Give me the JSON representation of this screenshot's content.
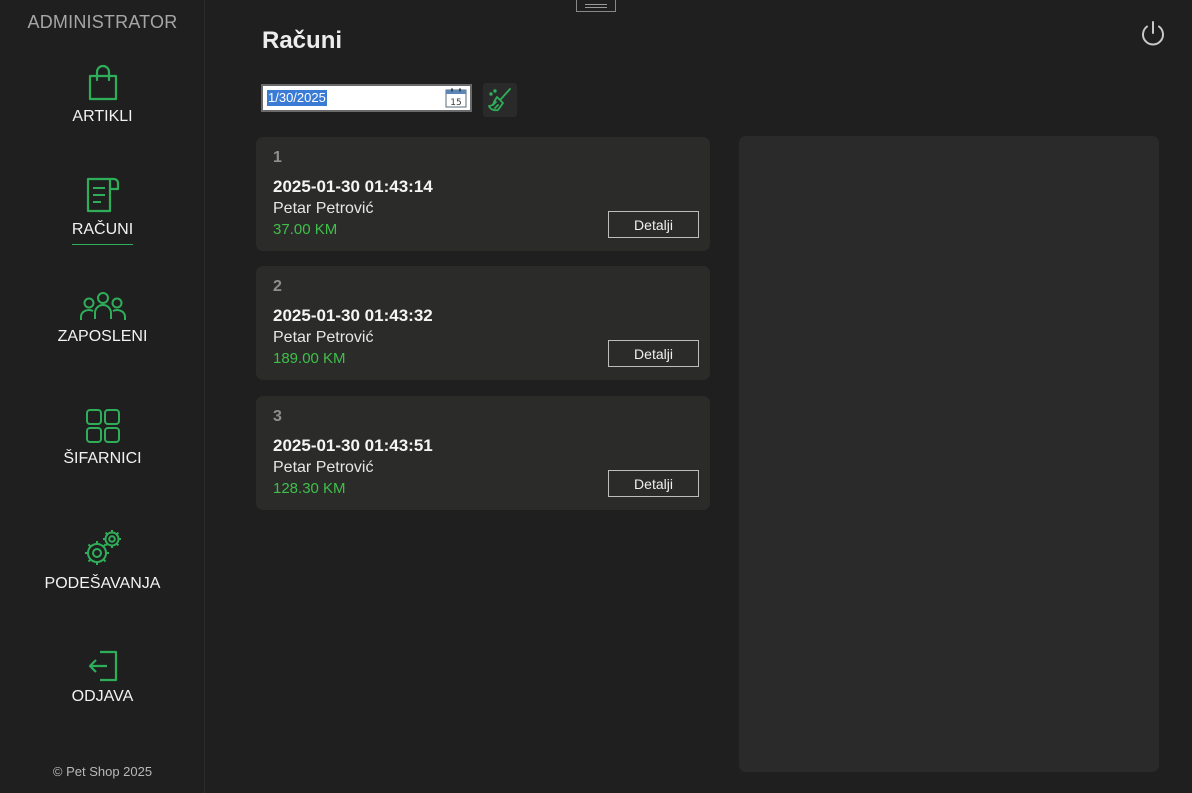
{
  "sidebar": {
    "role": "ADMINISTRATOR",
    "items": [
      {
        "label": "ARTIKLI",
        "icon": "shopping-bag-icon"
      },
      {
        "label": "RAČUNI",
        "icon": "receipt-icon",
        "active": true
      },
      {
        "label": "ZAPOSLENI",
        "icon": "users-icon"
      },
      {
        "label": "ŠIFARNICI",
        "icon": "grid-icon"
      },
      {
        "label": "PODEŠAVANJA",
        "icon": "gears-icon"
      },
      {
        "label": "ODJAVA",
        "icon": "logout-icon"
      }
    ],
    "footer": "© Pet Shop 2025"
  },
  "main": {
    "title": "Računi",
    "date_filter": {
      "value": "1/30/2025",
      "calendar_day": "15"
    },
    "bills": [
      {
        "number": "1",
        "datetime": "2025-01-30 01:43:14",
        "employee": "Petar Petrović",
        "amount": "37.00 KM",
        "details_label": "Detalji"
      },
      {
        "number": "2",
        "datetime": "2025-01-30 01:43:32",
        "employee": "Petar Petrović",
        "amount": "189.00 KM",
        "details_label": "Detalji"
      },
      {
        "number": "3",
        "datetime": "2025-01-30 01:43:51",
        "employee": "Petar Petrović",
        "amount": "128.30 KM",
        "details_label": "Detalji"
      }
    ]
  },
  "colors": {
    "accent": "#2fae5a",
    "amount": "#3fbf4a",
    "background": "#1f1f1f",
    "card": "#2b2c2a"
  }
}
